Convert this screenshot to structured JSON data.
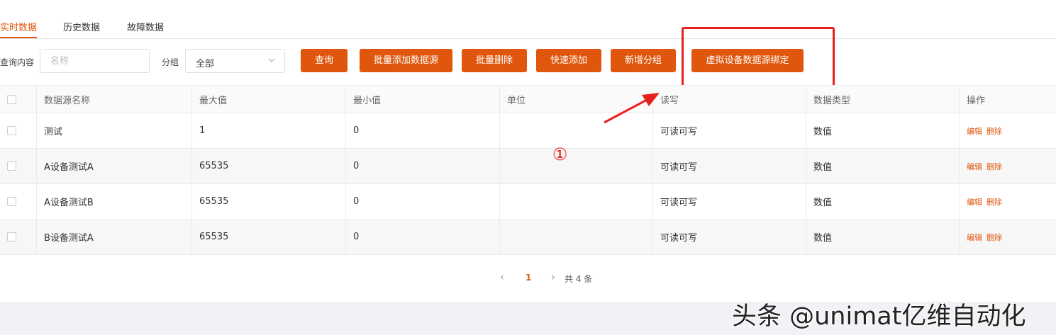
{
  "tabs": [
    {
      "label": "实时数据",
      "active": true
    },
    {
      "label": "历史数据",
      "active": false
    },
    {
      "label": "故障数据",
      "active": false
    }
  ],
  "filters": {
    "query_label": "查询内容",
    "query_placeholder": "名称",
    "query_value": "",
    "group_label": "分组",
    "group_value": "全部"
  },
  "toolbar": {
    "search": "查询",
    "batch_add": "批量添加数据源",
    "batch_delete": "批量删除",
    "quick_add": "快速添加",
    "add_group": "新增分组",
    "virtual_bind": "虚拟设备数据源绑定"
  },
  "table": {
    "columns": [
      "数据源名称",
      "最大值",
      "最小值",
      "单位",
      "读写",
      "数据类型",
      "操作"
    ],
    "rows": [
      {
        "name": "测试",
        "max": "1",
        "min": "0",
        "unit": "",
        "rw": "可读可写",
        "type": "数值"
      },
      {
        "name": "A设备测试A",
        "max": "65535",
        "min": "0",
        "unit": "",
        "rw": "可读可写",
        "type": "数值"
      },
      {
        "name": "A设备测试B",
        "max": "65535",
        "min": "0",
        "unit": "",
        "rw": "可读可写",
        "type": "数值"
      },
      {
        "name": "B设备测试A",
        "max": "65535",
        "min": "0",
        "unit": "",
        "rw": "可读可写",
        "type": "数值"
      }
    ],
    "actions": {
      "edit": "编辑",
      "delete": "删除"
    }
  },
  "annotation": {
    "marker": "①"
  },
  "pagination": {
    "prev": "‹",
    "current_page": "1",
    "next": "›",
    "total": "共 4 条"
  },
  "watermark": "头条 @unimat亿维自动化",
  "colors": {
    "accent": "#e0560c",
    "annotation": "#e8201a"
  },
  "icons": {
    "select": "chevron-down-icon",
    "prev": "chevron-left-icon",
    "next": "chevron-right-icon"
  }
}
